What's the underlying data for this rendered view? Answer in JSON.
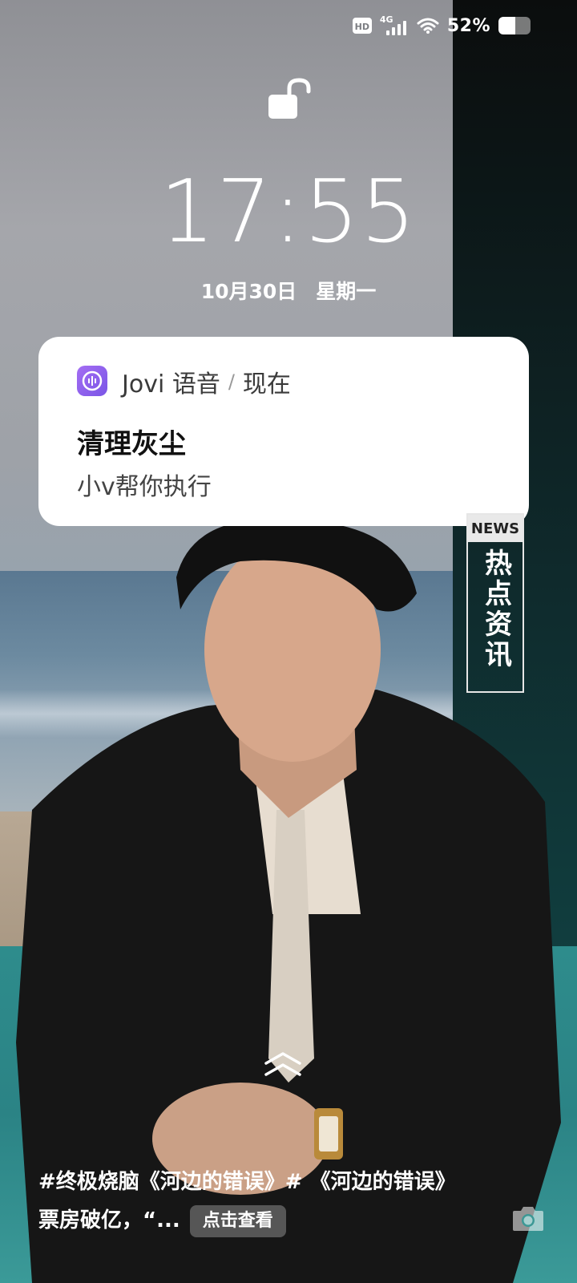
{
  "status_bar": {
    "hd_label": "HD",
    "network_type": "4G",
    "battery_percent_text": "52%",
    "battery_level": 0.52
  },
  "lock": {
    "icon": "unlocked-padlock-icon"
  },
  "clock": {
    "time": "17:55",
    "date": "10月30日",
    "weekday": "星期一"
  },
  "notification": {
    "app_icon": "jovi-voice-icon",
    "app_name": "Jovi 语音",
    "separator": "/",
    "time": "现在",
    "title": "清理灰尘",
    "body": "小v帮你执行"
  },
  "news_tag": {
    "head": "NEWS",
    "text": "热点资讯"
  },
  "bottom_news": {
    "text": "#终极烧脑《河边的错误》# 《河边的错误》票房破亿，“...",
    "action": "点击查看"
  },
  "colors": {
    "notification_bg": "#ffffff",
    "app_icon_accent": "#8f62ee"
  }
}
